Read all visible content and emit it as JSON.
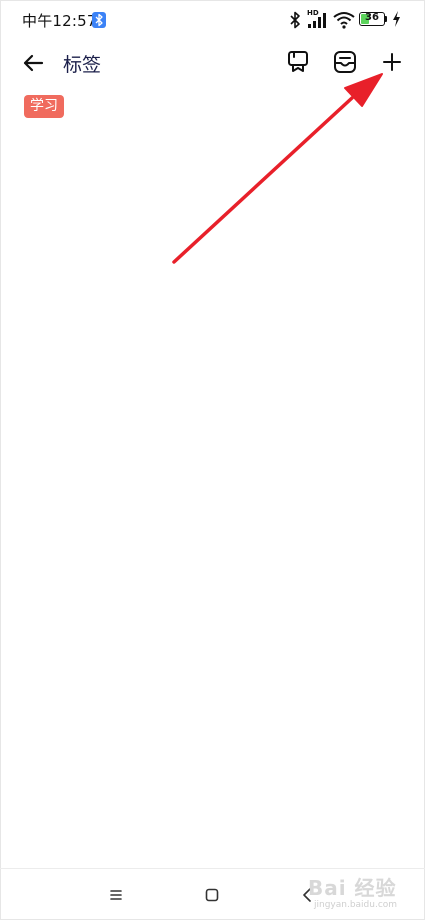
{
  "status_bar": {
    "time": "中午12:57",
    "bluetooth_badge_icon": "bluetooth-icon",
    "network_label": "HD",
    "battery_level": "36",
    "battery_percent": 36,
    "battery_fill_color": "#5bd35b"
  },
  "header": {
    "title": "标签",
    "back_icon": "arrow-left-icon",
    "icons": [
      "tag-board-icon",
      "inbox-icon",
      "plus-icon"
    ]
  },
  "tags": [
    {
      "label": "学习",
      "color": "#f06b5e"
    }
  ],
  "annotation": {
    "arrow_color": "#e8202a"
  },
  "watermark": {
    "main": "Bai 经验",
    "sub": "jingyan.baidu.com"
  },
  "nav_bar": {
    "icons": [
      "menu-icon",
      "home-square-icon",
      "back-chevron-icon"
    ]
  }
}
